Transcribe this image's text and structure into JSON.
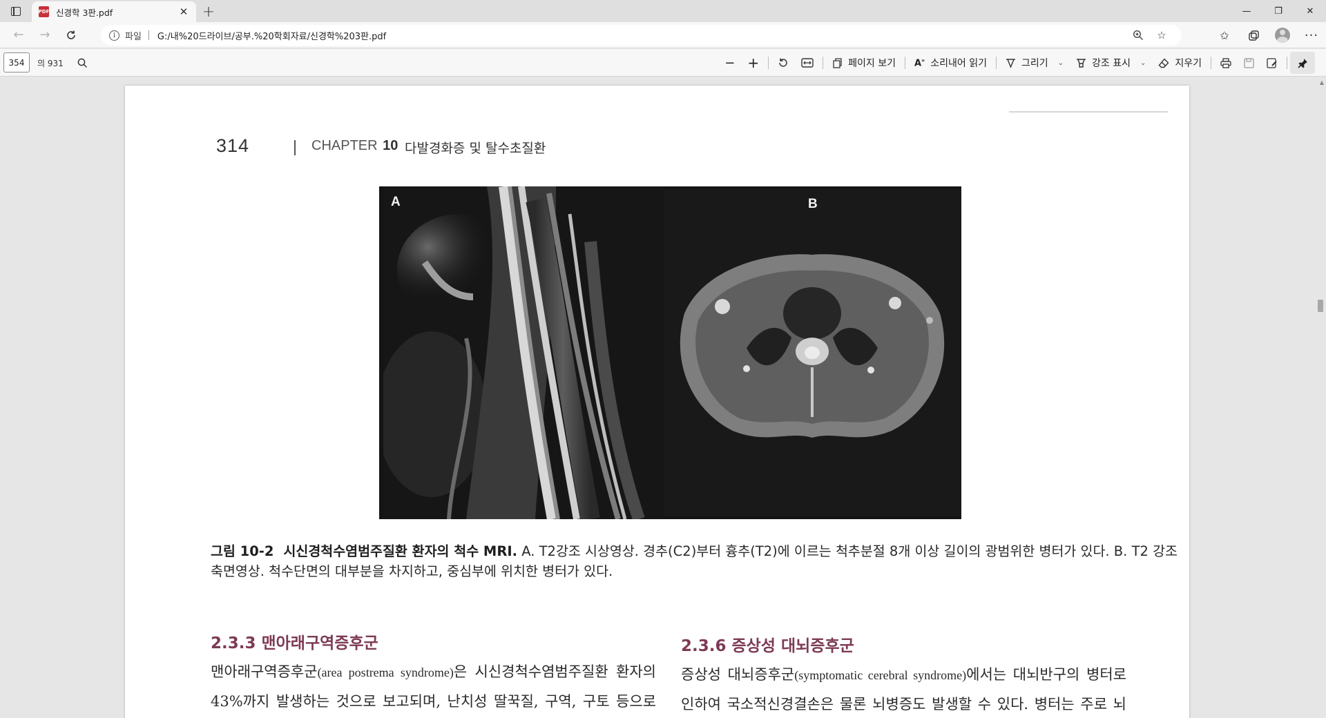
{
  "browser": {
    "tab_title": "신경학 3판.pdf",
    "tab_icon": "pdf-icon",
    "new_tab_label": "+",
    "url_scheme": "파일",
    "url": "G:/내%20드라이브/공부.%20학회자료/신경학%203판.pdf",
    "window_controls": [
      "—",
      "❐",
      "✕"
    ]
  },
  "pdf_toolbar": {
    "current_page": "354",
    "total_pages": "의 931",
    "page_view_label": "페이지 보기",
    "read_aloud_label": "소리내어 읽기",
    "draw_label": "그리기",
    "highlight_label": "강조 표시",
    "erase_label": "지우기"
  },
  "document": {
    "page_number": "314",
    "chapter_word": "CHAPTER",
    "chapter_num": "10",
    "chapter_title": "다발경화증 및 탈수초질환",
    "panel_a_label": "A",
    "panel_b_label": "B",
    "figure_label": "그림 10-2",
    "figure_title": "시신경척수염범주질환 환자의 척수 MRI.",
    "figure_caption": "A. T2강조 시상영상. 경추(C2)부터 흉추(T2)에 이르는 척추분절 8개 이상 길이의 광범위한 병터가 있다. B. T2 강조 축면영상. 척수단면의 대부분을 차지하고, 중심부에 위치한 병터가 있다.",
    "sec_left_title": "2.3.3  맨아래구역증후군",
    "sec_left_term": "맨아래구역증후군",
    "sec_left_en": "(area postrema syndrome)",
    "sec_left_rest": "은 시신경척수염범주질환 환자의 43%까지 발생하는 것으로 보고되며, 난치성 딸꾹질, 구역, 구토 등으로 발현된다. 다른 국소신경학적결손에 선행하여 나타나",
    "sec_right_title": "2.3.6  증상성 대뇌증후군",
    "sec_right_term": "증상성 대뇌증후군",
    "sec_right_en": "(symptomatic cerebral syndrome)",
    "sec_right_rest": "에서는 대뇌반구의 병터로 인하여 국소적신경결손은 물론 뇌병증도 발생할 수 있다. 병터는 주로 뇌실주위 백질에 위치하며 크기가 크고 부종을 동반하기도"
  },
  "colors": {
    "section_heading": "#7d3a55",
    "pdf_icon": "#c8323a"
  }
}
